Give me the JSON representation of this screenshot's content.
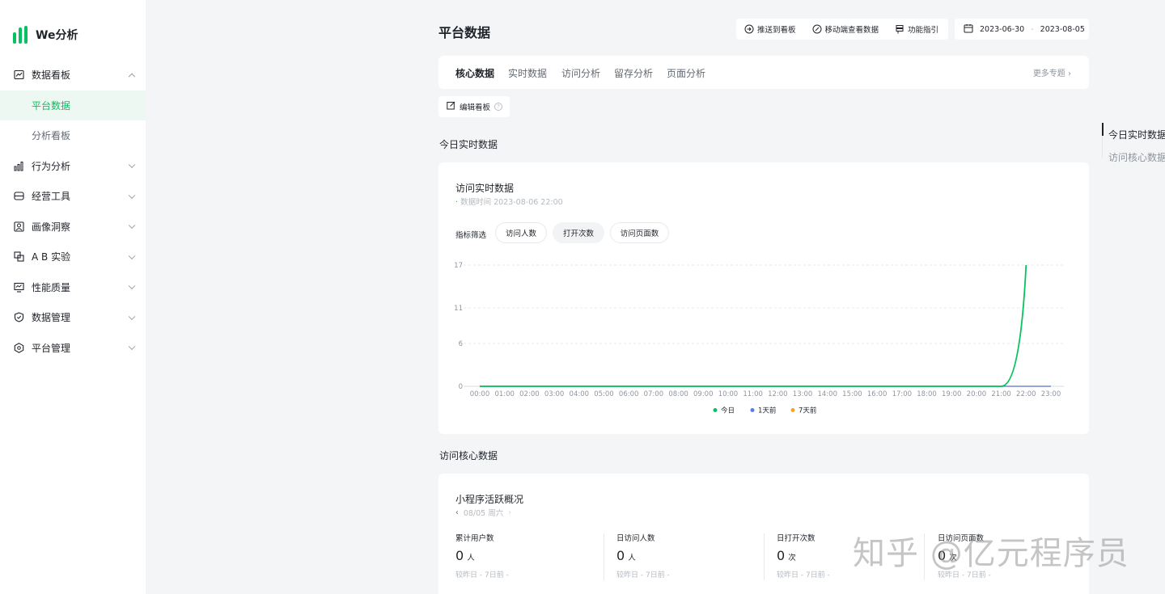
{
  "app": {
    "name": "We分析"
  },
  "sidebar": {
    "items": [
      {
        "label": "数据看板",
        "icon": "trend-board-icon",
        "expanded": true,
        "children": [
          {
            "label": "平台数据",
            "active": true
          },
          {
            "label": "分析看板",
            "active": false
          }
        ]
      },
      {
        "label": "行为分析",
        "icon": "bar-chart-icon"
      },
      {
        "label": "经营工具",
        "icon": "card-icon"
      },
      {
        "label": "画像洞察",
        "icon": "portrait-icon"
      },
      {
        "label": "A B 实验",
        "icon": "ab-test-icon"
      },
      {
        "label": "性能质量",
        "icon": "monitor-icon"
      },
      {
        "label": "数据管理",
        "icon": "shield-check-icon"
      },
      {
        "label": "平台管理",
        "icon": "hexagon-settings-icon"
      }
    ]
  },
  "header": {
    "title": "平台数据",
    "actions": [
      {
        "label": "推送到看板",
        "icon": "push-arrow-icon"
      },
      {
        "label": "移动端查看数据",
        "icon": "mobile-view-icon"
      },
      {
        "label": "功能指引",
        "icon": "signpost-icon"
      }
    ],
    "date_range": {
      "start": "2023-06-30",
      "separator": "-",
      "end": "2023-08-05",
      "icon": "calendar-icon"
    }
  },
  "tabs": {
    "items": [
      {
        "label": "核心数据",
        "active": true
      },
      {
        "label": "实时数据",
        "active": false
      },
      {
        "label": "访问分析",
        "active": false
      },
      {
        "label": "留存分析",
        "active": false
      },
      {
        "label": "页面分析",
        "active": false
      }
    ],
    "more": "更多专题"
  },
  "edit_board": {
    "label": "编辑看板"
  },
  "realtime": {
    "section_title": "今日实时数据",
    "card_title": "访问实时数据",
    "data_time": "数据时间 2023-08-06 22:00",
    "filter_label": "指标筛选",
    "filters": [
      {
        "label": "访问人数",
        "active": false
      },
      {
        "label": "打开次数",
        "active": true
      },
      {
        "label": "访问页面数",
        "active": false
      }
    ]
  },
  "chart_data": {
    "type": "line",
    "x": [
      "00:00",
      "01:00",
      "02:00",
      "03:00",
      "04:00",
      "05:00",
      "06:00",
      "07:00",
      "08:00",
      "09:00",
      "10:00",
      "11:00",
      "12:00",
      "13:00",
      "14:00",
      "15:00",
      "16:00",
      "17:00",
      "18:00",
      "19:00",
      "20:00",
      "21:00",
      "22:00",
      "23:00"
    ],
    "yticks": [
      0,
      6,
      11,
      17
    ],
    "ylim": [
      0,
      17
    ],
    "series": [
      {
        "name": "今日",
        "color": "#07c160",
        "values": [
          0,
          0,
          0,
          0,
          0,
          0,
          0,
          0,
          0,
          0,
          0,
          0,
          0,
          0,
          0,
          0,
          0,
          0,
          0,
          0,
          0,
          0,
          17,
          null
        ]
      },
      {
        "name": "1天前",
        "color": "#5b7ce8",
        "values": [
          0,
          0,
          0,
          0,
          0,
          0,
          0,
          0,
          0,
          0,
          0,
          0,
          0,
          0,
          0,
          0,
          0,
          0,
          0,
          0,
          0,
          0,
          0,
          0
        ]
      },
      {
        "name": "7天前",
        "color": "#f5a623",
        "values": [
          0,
          0,
          0,
          0,
          0,
          0,
          0,
          0,
          0,
          0,
          0,
          0,
          0,
          0,
          0,
          0,
          0,
          0,
          0,
          0,
          0,
          0,
          0,
          0
        ]
      }
    ],
    "grid": true,
    "legend": "bottom-center"
  },
  "core": {
    "section_title": "访问核心数据",
    "card_title": "小程序活跃概况",
    "date": "08/05 周六",
    "metrics": [
      {
        "label": "累计用户数",
        "value": "0",
        "unit": "人",
        "compare": "较昨日 -    7日前 -"
      },
      {
        "label": "日访问人数",
        "value": "0",
        "unit": "人",
        "compare": "较昨日 -    7日前 -"
      },
      {
        "label": "日打开次数",
        "value": "0",
        "unit": "次",
        "compare": "较昨日 -    7日前 -"
      },
      {
        "label": "日访问页面数",
        "value": "0",
        "unit": "次",
        "compare": "较昨日 -    7日前 -"
      }
    ]
  },
  "anchor": {
    "items": [
      {
        "label": "今日实时数据",
        "active": true
      },
      {
        "label": "访问核心数据",
        "active": false
      }
    ]
  },
  "watermark": "知乎 @亿元程序员"
}
